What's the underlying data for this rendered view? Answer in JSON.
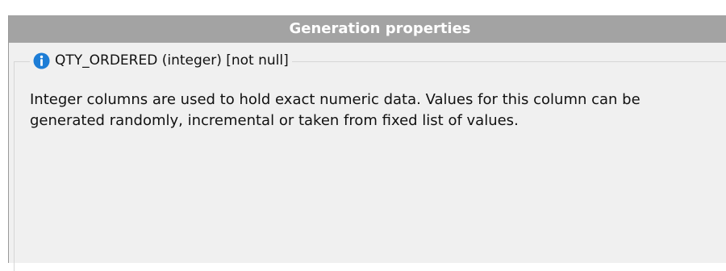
{
  "header": {
    "title": "Generation properties"
  },
  "column": {
    "label": "QTY_ORDERED (integer) [not null]",
    "icon": "info-icon"
  },
  "description": {
    "text": "Integer columns are used to hold exact numeric data. Values for this column can be generated randomly, incremental or taken from fixed list of values."
  },
  "colors": {
    "header_bg": "#a3a3a3",
    "panel_bg": "#f0f0f0",
    "info_icon": "#1d7dd6"
  }
}
